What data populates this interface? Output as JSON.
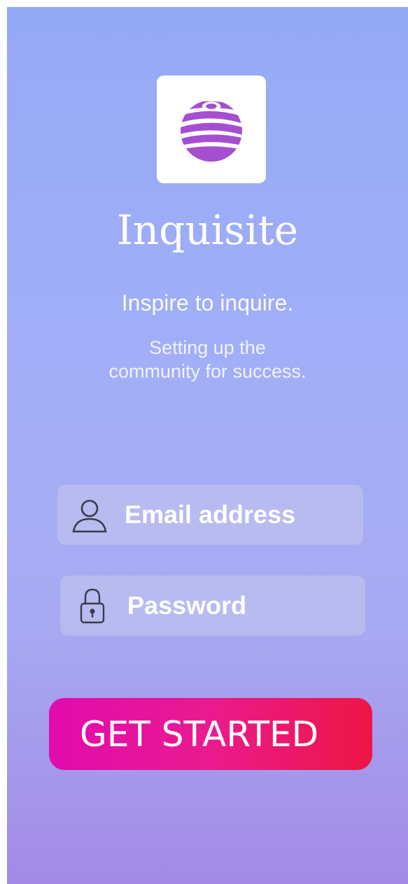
{
  "app": {
    "name": "Inquisite",
    "tagline": "Inspire to inquire.",
    "subtitle_lines": [
      "Setting up the",
      "community for success."
    ],
    "logo_color": "#a54fd0"
  },
  "login_form": {
    "email": {
      "placeholder": "Email address",
      "value": "",
      "icon": "user-icon"
    },
    "password": {
      "placeholder": "Password",
      "value": "",
      "icon": "lock-icon"
    },
    "submit_label": "GET STARTED"
  },
  "colors": {
    "background_top": "#94aaf6",
    "background_bottom": "#a38ae6",
    "button_start": "#e20bb0",
    "button_end": "#ee1644"
  }
}
